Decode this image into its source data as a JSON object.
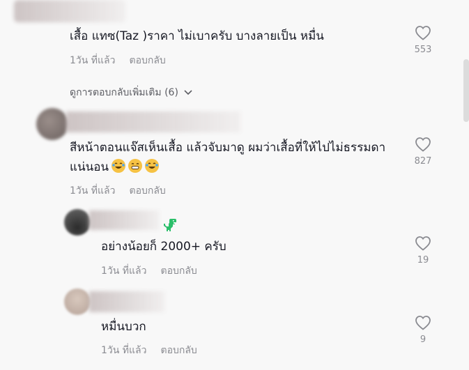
{
  "comments": [
    {
      "text": "เสื้อ แทซ(Taz )ราคา  ไม่เบาครับ บางลายเป็น หมื่น",
      "time": "1วัน ที่แล้ว",
      "reply_label": "ตอบกลับ",
      "likes": "553"
    },
    {
      "text": "สีหน้าตอนแจ๊สเห็นเสื้อ แล้วจับมาดู ผมว่าเสื้อที่ให้ไปไม่ธรรมดาแน่นอน",
      "time": "1วัน ที่แล้ว",
      "reply_label": "ตอบกลับ",
      "likes": "827",
      "emojis": [
        "laughing-tears-emoji",
        "grinning-emoji",
        "laughing-tears-emoji"
      ]
    }
  ],
  "view_more": {
    "label": "ดูการตอบกลับเพิ่มเติม (6)"
  },
  "replies": [
    {
      "text": "อย่างน้อยก็ 2000+ ครับ",
      "time": "1วัน ที่แล้ว",
      "reply_label": "ตอบกลับ",
      "likes": "19",
      "badge_icon": "dinosaur-icon"
    },
    {
      "text": "หมื่นบวก",
      "time": "1วัน ที่แล้ว",
      "reply_label": "ตอบกลับ",
      "likes": "9"
    }
  ],
  "colors": {
    "background": "#f8f8f8",
    "text": "#161823",
    "meta": "#8a8b91",
    "dino": "#2bbf6a"
  }
}
